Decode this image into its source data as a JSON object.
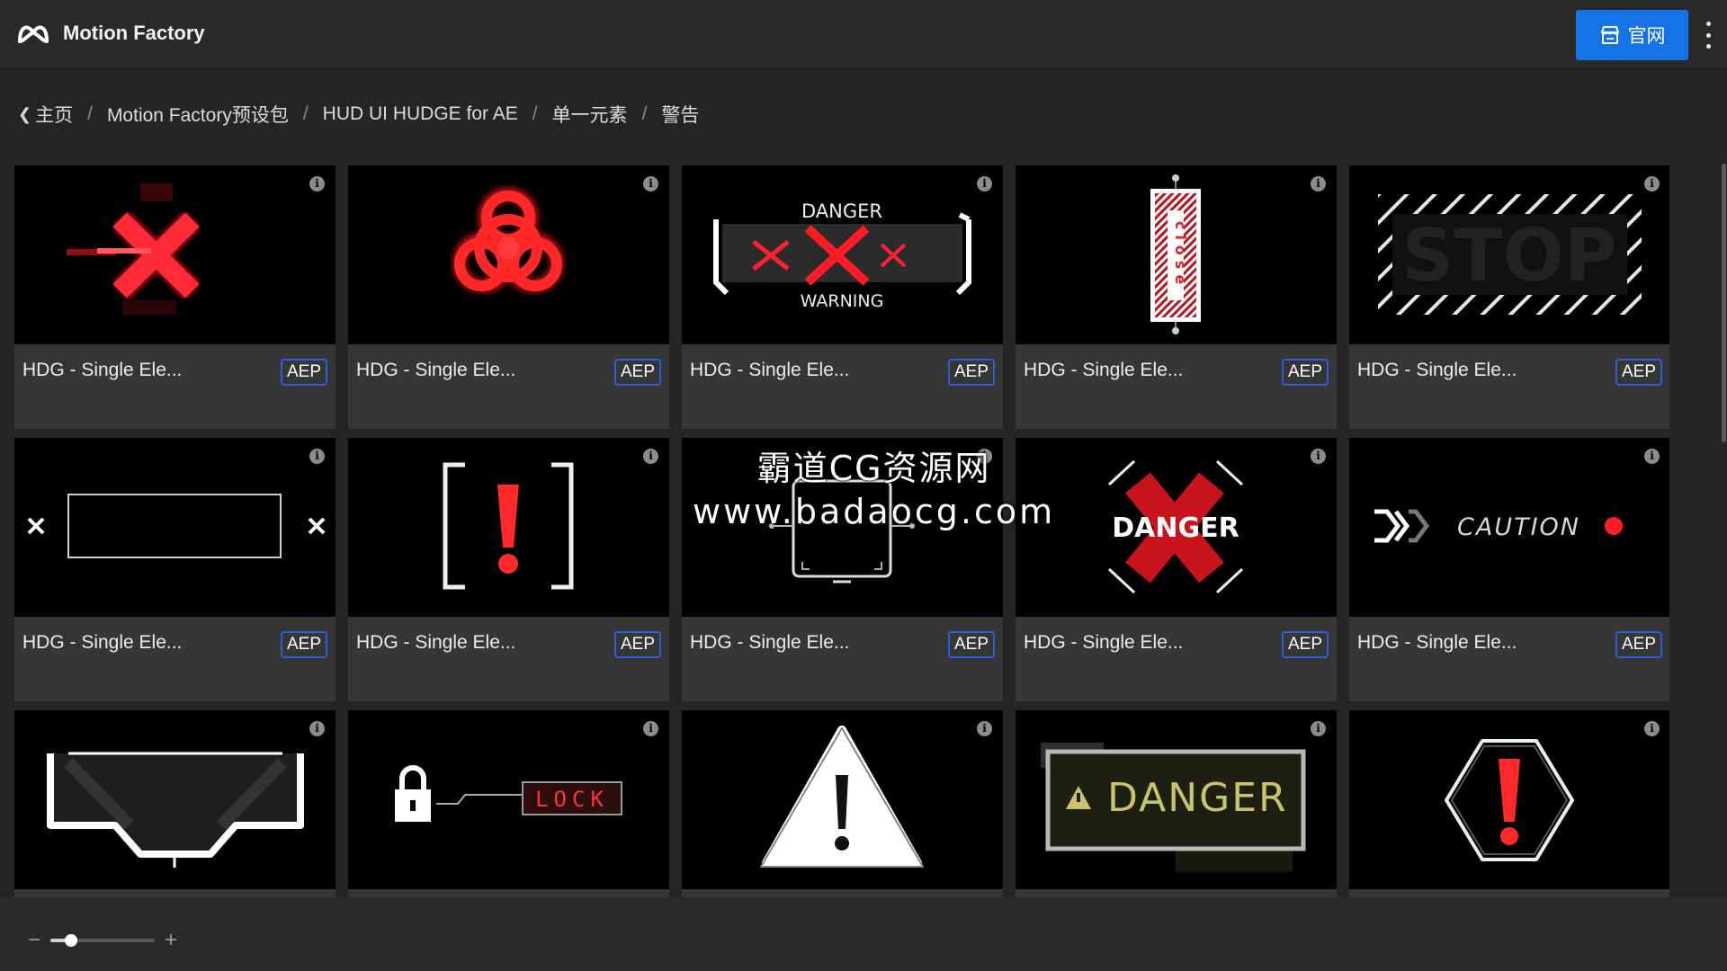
{
  "app": {
    "name": "Motion Factory",
    "logo_icon": "motion-factory-logo-icon"
  },
  "header": {
    "site_button_label": "官网",
    "site_button_icon": "store-icon",
    "menu_icon": "more-vertical-icon",
    "accent": "#1473e6"
  },
  "breadcrumb": {
    "back_icon": "chevron-left-icon",
    "items": [
      "主页",
      "Motion Factory预设包",
      "HUD UI HUDGE for AE",
      "单一元素",
      "警告"
    ]
  },
  "cards": [
    {
      "title": "HDG - Single Ele...",
      "badge": "AEP",
      "thumb": "red-x-glitch"
    },
    {
      "title": "HDG - Single Ele...",
      "badge": "AEP",
      "thumb": "biohazard"
    },
    {
      "title": "HDG - Single Ele...",
      "badge": "AEP",
      "thumb": "danger-warning",
      "text_top": "DANGER",
      "text_bottom": "WARNING"
    },
    {
      "title": "HDG - Single Ele...",
      "badge": "AEP",
      "thumb": "close-tag",
      "text": "close"
    },
    {
      "title": "HDG - Single Ele...",
      "badge": "AEP",
      "thumb": "stop-hatch",
      "text": "STOP"
    },
    {
      "title": "HDG - Single Ele...",
      "badge": "AEP",
      "thumb": "x-box"
    },
    {
      "title": "HDG - Single Ele...",
      "badge": "AEP",
      "thumb": "exclaim-bracket"
    },
    {
      "title": "HDG - Single Ele...",
      "badge": "AEP",
      "thumb": "monitor-frame"
    },
    {
      "title": "HDG - Single Ele...",
      "badge": "AEP",
      "thumb": "danger-x",
      "text": "DANGER"
    },
    {
      "title": "HDG - Single Ele...",
      "badge": "AEP",
      "thumb": "caution",
      "text": "CAUTION"
    },
    {
      "title": "",
      "badge": "",
      "thumb": "bracket-funnel"
    },
    {
      "title": "",
      "badge": "",
      "thumb": "lock",
      "text": "LOCK"
    },
    {
      "title": "",
      "badge": "",
      "thumb": "warning-triangle"
    },
    {
      "title": "",
      "badge": "",
      "thumb": "danger-sign",
      "text": "DANGER"
    },
    {
      "title": "",
      "badge": "",
      "thumb": "hex-exclaim"
    }
  ],
  "watermark": {
    "line1": "霸道CG资源网",
    "line2": "www.badaocg.com"
  },
  "zoom": {
    "minus": "−",
    "plus": "+",
    "level": 0.2
  }
}
